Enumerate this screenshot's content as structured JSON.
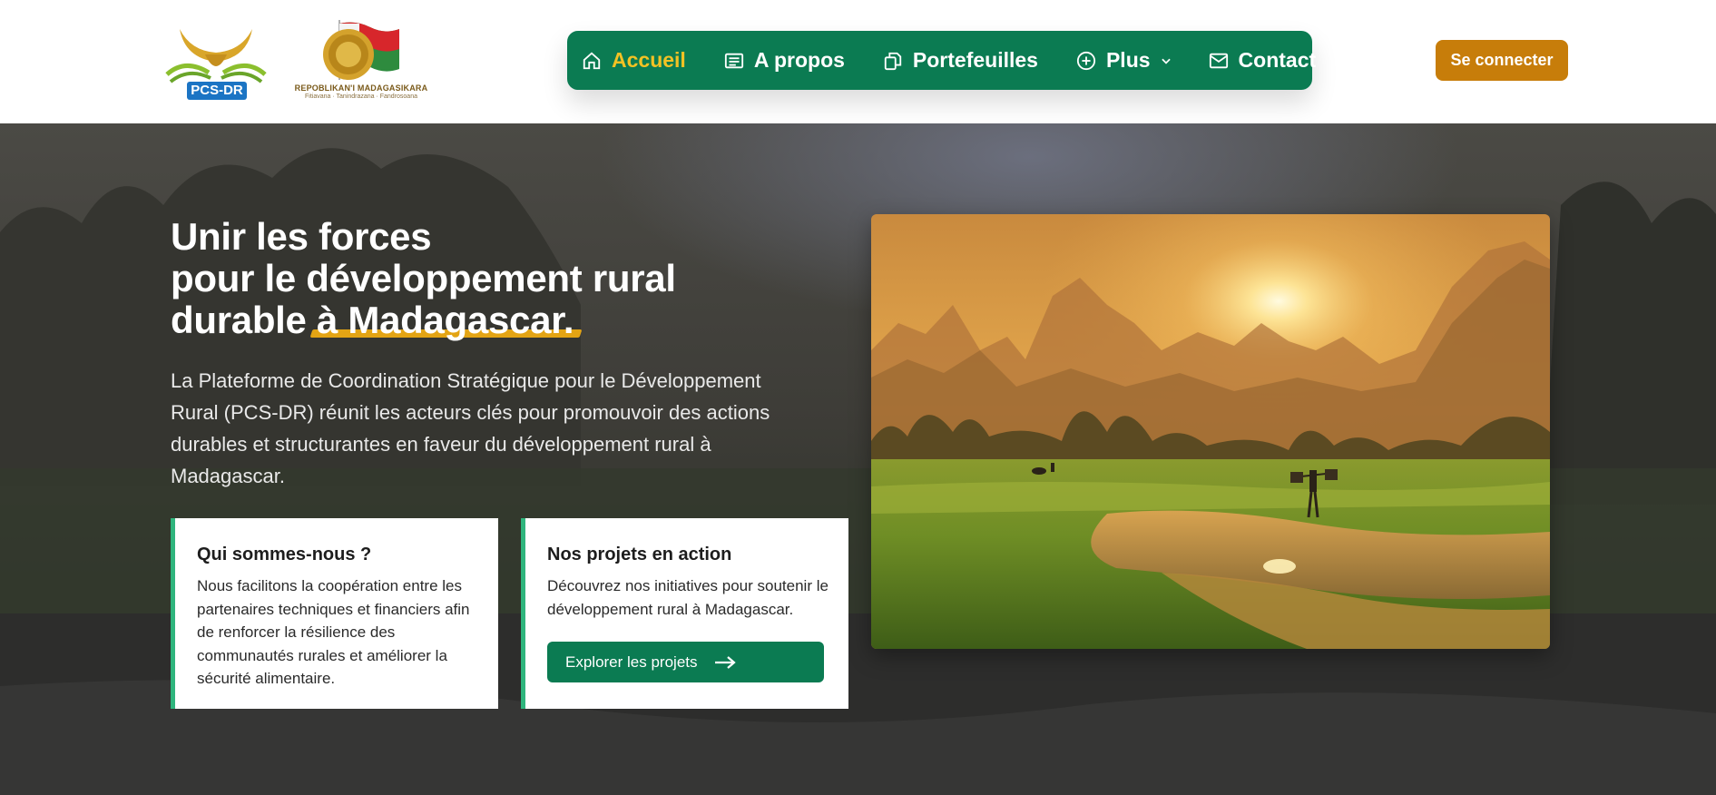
{
  "header": {
    "logo_left": {
      "text": "PCS-DR",
      "icon": "pcs-dr-logo-icon"
    },
    "logo_right": {
      "text": "REPOBLIKAN'I MADAGASIKARA",
      "motto": "Fitiavana · Tanindrazana · Fandrosoana",
      "icon": "madagascar-seal-flag-icon"
    },
    "nav": [
      {
        "label": "Accueil",
        "icon": "home-icon",
        "active": true
      },
      {
        "label": "A propos",
        "icon": "list-icon",
        "active": false
      },
      {
        "label": "Portefeuilles",
        "icon": "files-icon",
        "active": false
      },
      {
        "label": "Plus",
        "icon": "plus-circle-icon",
        "active": false,
        "dropdown": true
      },
      {
        "label": "Contact",
        "icon": "mail-icon",
        "active": false
      }
    ],
    "login_label": "Se connecter"
  },
  "hero": {
    "title_line1": "Unir les forces",
    "title_line2": "pour le développement rural",
    "title_line3_prefix": "durable ",
    "title_line3_highlight": "à Madagascar.",
    "description": "La Plateforme de Coordination Stratégique pour le Développement Rural (PCS-DR) réunit les acteurs clés pour promouvoir des actions durables et structurantes en faveur du développement rural à Madagascar.",
    "cards": [
      {
        "title": "Qui sommes-nous ?",
        "text": "Nous facilitons la coopération entre les partenaires techniques et financiers afin de renforcer la résilience des communautés rurales et améliorer la sécurité alimentaire."
      },
      {
        "title": "Nos projets en action",
        "text": "Découvrez nos initiatives pour soutenir le développement rural à Madagascar.",
        "button_label": "Explorer les projets",
        "button_icon": "arrow-right-icon"
      }
    ]
  },
  "colors": {
    "primary_green": "#0b7b52",
    "accent_yellow": "#f2c224",
    "login_orange": "#c77d0a",
    "highlight": "#e3a414",
    "card_border": "#2fb57d"
  }
}
